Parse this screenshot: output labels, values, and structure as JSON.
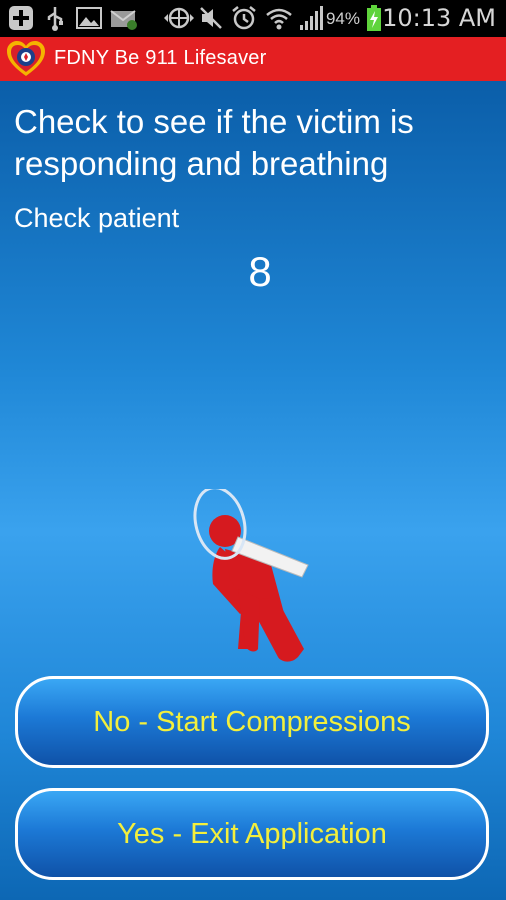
{
  "status_bar": {
    "battery_percent": "94%",
    "time": "10:13 AM",
    "icons": [
      "plus-icon",
      "usb-icon",
      "image-icon",
      "mail-icon",
      "data-sync-icon",
      "mute-icon",
      "alarm-icon",
      "wifi-icon",
      "signal-icon",
      "battery-charging-icon"
    ]
  },
  "app_bar": {
    "title": "FDNY Be 911 Lifesaver",
    "color": "#e41f22"
  },
  "main": {
    "headline": "Check to see if the victim is responding and breathing",
    "subhead": "Check patient",
    "counter": "8"
  },
  "buttons": {
    "no_label": "No - Start Compressions",
    "yes_label": "Yes - Exit Application",
    "text_color": "#f3ef3c"
  }
}
